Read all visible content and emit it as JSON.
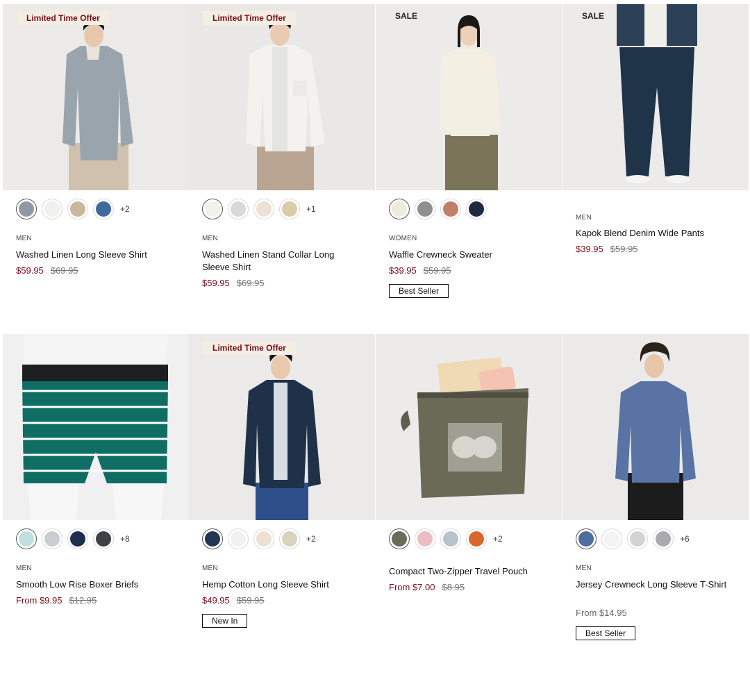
{
  "products": [
    {
      "badge": "Limited Time Offer",
      "swatch_colors": [
        "#8e99a3",
        "#f2f0ec",
        "#c9b79d",
        "#3f6b9c"
      ],
      "more": "+2",
      "category": "MEN",
      "title": "Washed Linen Long Sleeve Shirt",
      "price": "$59.95",
      "was": "$69.95"
    },
    {
      "badge": "Limited Time Offer",
      "swatch_colors": [
        "#f3f1ec",
        "#d9d9d9",
        "#e6dccc",
        "#d8ccaa"
      ],
      "more": "+1",
      "category": "MEN",
      "title": "Washed Linen Stand Collar Long Sleeve Shirt",
      "price": "$59.95",
      "was": "$69.95"
    },
    {
      "sale": "SALE",
      "swatch_colors": [
        "#efeadb",
        "#8f8f8d",
        "#c07f68",
        "#1e2a40"
      ],
      "category": "WOMEN",
      "title": "Waffle Crewneck Sweater",
      "price": "$39.95",
      "was": "$59.95",
      "tag": "Best Seller"
    },
    {
      "sale": "SALE",
      "category": "MEN",
      "title": "Kapok Blend Denim Wide Pants",
      "price": "$39.95",
      "was": "$59.95"
    },
    {
      "swatch_colors": [
        "#bfe0dc",
        "#c9cdd2",
        "#1f2e4d",
        "#3f4244"
      ],
      "more": "+8",
      "category": "MEN",
      "title": "Smooth Low Rise Boxer Briefs",
      "price": "From $9.95",
      "was": "$12.95"
    },
    {
      "badge": "Limited Time Offer",
      "swatch_colors": [
        "#223652",
        "#f1f1f1",
        "#ece2d3",
        "#d9d2bd"
      ],
      "more": "+2",
      "category": "MEN",
      "title": "Hemp Cotton Long Sleeve Shirt",
      "price": "$49.95",
      "was": "$59.95",
      "tag": "New In"
    },
    {
      "swatch_colors": [
        "#6b6b58",
        "#e9bfc4",
        "#b9c2cc",
        "#d9672c"
      ],
      "more": "+2",
      "title": "Compact Two-Zipper Travel Pouch",
      "price": "From $7.00",
      "was": "$8.95"
    },
    {
      "swatch_colors": [
        "#4f6c9e",
        "#f3f3f3",
        "#d3d3d3",
        "#a9aaae"
      ],
      "more": "+6",
      "category": "MEN",
      "title": "Jersey Crewneck Long Sleeve T-Shirt",
      "price_plain": "From $14.95",
      "tag": "Best Seller"
    }
  ]
}
